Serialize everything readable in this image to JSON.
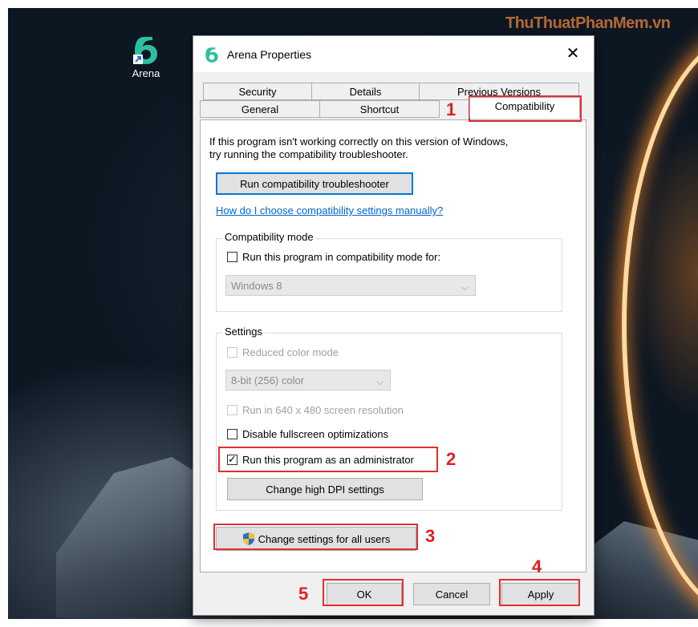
{
  "desktop": {
    "icon_label": "Arena",
    "watermark": "ThuThuatPhanMem.vn"
  },
  "dialog": {
    "title": "Arena Properties",
    "tabs_row1": [
      "Security",
      "Details",
      "Previous Versions"
    ],
    "tabs_row2": [
      "General",
      "Shortcut",
      "Compatibility"
    ],
    "intro_line1": "If this program isn't working correctly on this version of Windows,",
    "intro_line2": "try running the compatibility troubleshooter.",
    "troubleshooter_button": "Run compatibility troubleshooter",
    "help_link": "How do I choose compatibility settings manually?",
    "compat_group": {
      "label": "Compatibility mode",
      "checkbox_label": "Run this program in compatibility mode for:",
      "checked": false,
      "os_value": "Windows 8"
    },
    "settings_group": {
      "label": "Settings",
      "reduced_color": "Reduced color mode",
      "color_value": "8-bit (256) color",
      "res_640": "Run in 640 x 480 screen resolution",
      "disable_fullscreen": "Disable fullscreen optimizations",
      "run_as_admin": "Run this program as an administrator",
      "run_as_admin_checked": true,
      "high_dpi_button": "Change high DPI settings"
    },
    "all_users_button": "Change settings for all users",
    "ok": "OK",
    "cancel": "Cancel",
    "apply": "Apply"
  },
  "annotations": {
    "n1": "1",
    "n2": "2",
    "n3": "3",
    "n4": "4",
    "n5": "5"
  },
  "colors": {
    "highlight": "#e03030",
    "link": "#0066cc",
    "focus": "#0078d7"
  }
}
